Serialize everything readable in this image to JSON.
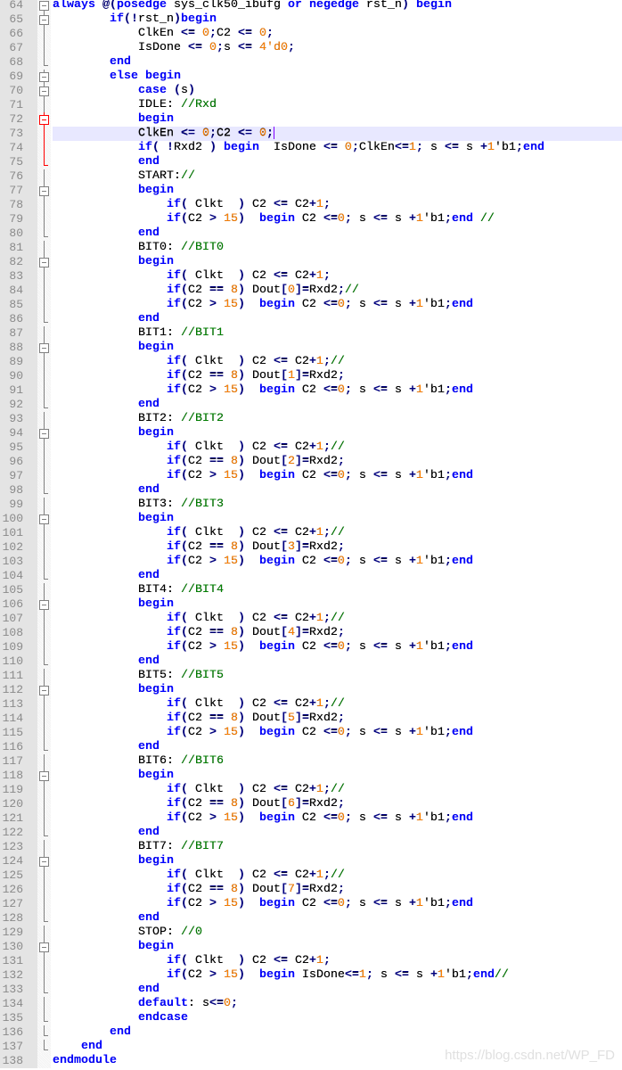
{
  "editor": {
    "current_line": 73,
    "cursor_after": "ClkEn <= 0;C2 <= 0;",
    "colors": {
      "keyword": "#0000ff",
      "number": "#ff8000",
      "comment": "#008000",
      "operator": "#000080",
      "current_line": "#e8e8ff"
    },
    "lines": [
      {
        "n": "64",
        "fold": "open-top",
        "code": "always @(posedge sys_clk50_ibufg or negedge rst_n) begin"
      },
      {
        "n": "65",
        "fold": "open",
        "code": "        if(!rst_n)begin"
      },
      {
        "n": "66",
        "fold": "mid",
        "code": "            ClkEn <= 0;C2 <= 0;"
      },
      {
        "n": "67",
        "fold": "mid",
        "code": "            IsDone <= 0;s <= 4'd0;"
      },
      {
        "n": "68",
        "fold": "end",
        "code": "        end"
      },
      {
        "n": "69",
        "fold": "open",
        "code": "        else begin"
      },
      {
        "n": "70",
        "fold": "open",
        "code": "            case (s)"
      },
      {
        "n": "71",
        "fold": "mid",
        "code": "            IDLE: //Rxd"
      },
      {
        "n": "72",
        "fold": "open-red",
        "code": "            begin"
      },
      {
        "n": "73",
        "fold": "mid-red",
        "code": "            ClkEn <= 0;C2 <= 0;"
      },
      {
        "n": "74",
        "fold": "mid-red",
        "code": "            if( !Rxd2 ) begin  IsDone <= 0;ClkEn<=1; s <= s +1'b1;end"
      },
      {
        "n": "75",
        "fold": "end-red",
        "code": "            end"
      },
      {
        "n": "76",
        "fold": "mid",
        "code": "            START://"
      },
      {
        "n": "77",
        "fold": "open",
        "code": "            begin"
      },
      {
        "n": "78",
        "fold": "mid",
        "code": "                if( Clkt  ) C2 <= C2+1;"
      },
      {
        "n": "79",
        "fold": "mid",
        "code": "                if(C2 > 15)  begin C2 <=0; s <= s +1'b1;end //"
      },
      {
        "n": "80",
        "fold": "end",
        "code": "            end"
      },
      {
        "n": "81",
        "fold": "mid",
        "code": "            BIT0: //BIT0"
      },
      {
        "n": "82",
        "fold": "open",
        "code": "            begin"
      },
      {
        "n": "83",
        "fold": "mid",
        "code": "                if( Clkt  ) C2 <= C2+1;"
      },
      {
        "n": "84",
        "fold": "mid",
        "code": "                if(C2 == 8) Dout[0]=Rxd2;//"
      },
      {
        "n": "85",
        "fold": "mid",
        "code": "                if(C2 > 15)  begin C2 <=0; s <= s +1'b1;end"
      },
      {
        "n": "86",
        "fold": "end",
        "code": "            end"
      },
      {
        "n": "87",
        "fold": "mid",
        "code": "            BIT1: //BIT1"
      },
      {
        "n": "88",
        "fold": "open",
        "code": "            begin"
      },
      {
        "n": "89",
        "fold": "mid",
        "code": "                if( Clkt  ) C2 <= C2+1;//"
      },
      {
        "n": "90",
        "fold": "mid",
        "code": "                if(C2 == 8) Dout[1]=Rxd2;"
      },
      {
        "n": "91",
        "fold": "mid",
        "code": "                if(C2 > 15)  begin C2 <=0; s <= s +1'b1;end"
      },
      {
        "n": "92",
        "fold": "end",
        "code": "            end"
      },
      {
        "n": "93",
        "fold": "mid",
        "code": "            BIT2: //BIT2"
      },
      {
        "n": "94",
        "fold": "open",
        "code": "            begin"
      },
      {
        "n": "95",
        "fold": "mid",
        "code": "                if( Clkt  ) C2 <= C2+1;//"
      },
      {
        "n": "96",
        "fold": "mid",
        "code": "                if(C2 == 8) Dout[2]=Rxd2;"
      },
      {
        "n": "97",
        "fold": "mid",
        "code": "                if(C2 > 15)  begin C2 <=0; s <= s +1'b1;end"
      },
      {
        "n": "98",
        "fold": "end",
        "code": "            end"
      },
      {
        "n": "99",
        "fold": "mid",
        "code": "            BIT3: //BIT3"
      },
      {
        "n": "100",
        "fold": "open",
        "code": "            begin"
      },
      {
        "n": "101",
        "fold": "mid",
        "code": "                if( Clkt  ) C2 <= C2+1;//"
      },
      {
        "n": "102",
        "fold": "mid",
        "code": "                if(C2 == 8) Dout[3]=Rxd2;"
      },
      {
        "n": "103",
        "fold": "mid",
        "code": "                if(C2 > 15)  begin C2 <=0; s <= s +1'b1;end"
      },
      {
        "n": "104",
        "fold": "end",
        "code": "            end"
      },
      {
        "n": "105",
        "fold": "mid",
        "code": "            BIT4: //BIT4"
      },
      {
        "n": "106",
        "fold": "open",
        "code": "            begin"
      },
      {
        "n": "107",
        "fold": "mid",
        "code": "                if( Clkt  ) C2 <= C2+1;//"
      },
      {
        "n": "108",
        "fold": "mid",
        "code": "                if(C2 == 8) Dout[4]=Rxd2;"
      },
      {
        "n": "109",
        "fold": "mid",
        "code": "                if(C2 > 15)  begin C2 <=0; s <= s +1'b1;end"
      },
      {
        "n": "110",
        "fold": "end",
        "code": "            end"
      },
      {
        "n": "111",
        "fold": "mid",
        "code": "            BIT5: //BIT5"
      },
      {
        "n": "112",
        "fold": "open",
        "code": "            begin"
      },
      {
        "n": "113",
        "fold": "mid",
        "code": "                if( Clkt  ) C2 <= C2+1;//"
      },
      {
        "n": "114",
        "fold": "mid",
        "code": "                if(C2 == 8) Dout[5]=Rxd2;"
      },
      {
        "n": "115",
        "fold": "mid",
        "code": "                if(C2 > 15)  begin C2 <=0; s <= s +1'b1;end"
      },
      {
        "n": "116",
        "fold": "end",
        "code": "            end"
      },
      {
        "n": "117",
        "fold": "mid",
        "code": "            BIT6: //BIT6"
      },
      {
        "n": "118",
        "fold": "open",
        "code": "            begin"
      },
      {
        "n": "119",
        "fold": "mid",
        "code": "                if( Clkt  ) C2 <= C2+1;//"
      },
      {
        "n": "120",
        "fold": "mid",
        "code": "                if(C2 == 8) Dout[6]=Rxd2;"
      },
      {
        "n": "121",
        "fold": "mid",
        "code": "                if(C2 > 15)  begin C2 <=0; s <= s +1'b1;end"
      },
      {
        "n": "122",
        "fold": "end",
        "code": "            end"
      },
      {
        "n": "123",
        "fold": "mid",
        "code": "            BIT7: //BIT7"
      },
      {
        "n": "124",
        "fold": "open",
        "code": "            begin"
      },
      {
        "n": "125",
        "fold": "mid",
        "code": "                if( Clkt  ) C2 <= C2+1;//"
      },
      {
        "n": "126",
        "fold": "mid",
        "code": "                if(C2 == 8) Dout[7]=Rxd2;"
      },
      {
        "n": "127",
        "fold": "mid",
        "code": "                if(C2 > 15)  begin C2 <=0; s <= s +1'b1;end"
      },
      {
        "n": "128",
        "fold": "end",
        "code": "            end"
      },
      {
        "n": "129",
        "fold": "mid",
        "code": "            STOP: //0"
      },
      {
        "n": "130",
        "fold": "open",
        "code": "            begin"
      },
      {
        "n": "131",
        "fold": "mid",
        "code": "                if( Clkt  ) C2 <= C2+1;"
      },
      {
        "n": "132",
        "fold": "mid",
        "code": "                if(C2 > 15)  begin IsDone<=1; s <= s +1'b1;end//"
      },
      {
        "n": "133",
        "fold": "end",
        "code": "            end"
      },
      {
        "n": "134",
        "fold": "mid",
        "code": "            default: s<=0;"
      },
      {
        "n": "135",
        "fold": "end",
        "code": "            endcase"
      },
      {
        "n": "136",
        "fold": "end",
        "code": "        end"
      },
      {
        "n": "137",
        "fold": "end",
        "code": "    end"
      },
      {
        "n": "138",
        "fold": "none",
        "code": "endmodule"
      }
    ]
  },
  "watermark": "https://blog.csdn.net/WP_FD"
}
